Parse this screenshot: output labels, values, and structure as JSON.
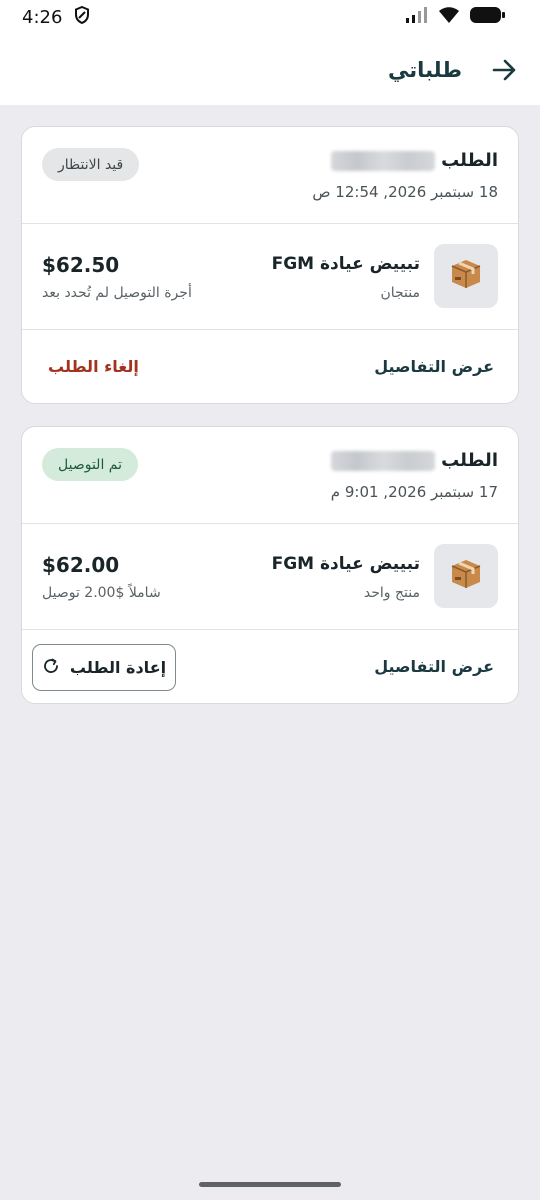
{
  "status_bar": {
    "time": "4:26"
  },
  "header": {
    "title": "طلباتي"
  },
  "orders": [
    {
      "order_label": "الطلب",
      "date": "18 سبتمبر 2026, 12:54 ص",
      "status": "قيد الانتظار",
      "product_name": "تبييض عيادة FGM",
      "product_count": "منتجان",
      "price": "$62.50",
      "price_note": "أجرة التوصيل لم تُحدد بعد",
      "details_label": "عرض التفاصيل",
      "action_label": "إلغاء الطلب"
    },
    {
      "order_label": "الطلب",
      "date": "17 سبتمبر 2026, 9:01 م",
      "status": "تم التوصيل",
      "product_name": "تبييض عيادة FGM",
      "product_count": "منتج واحد",
      "price": "$62.00",
      "price_note": "شاملاً $2.00 توصيل",
      "details_label": "عرض التفاصيل",
      "action_label": "إعادة الطلب"
    }
  ],
  "colors": {
    "pending_pill": "#e5e6e8",
    "delivered_pill": "#d4ebdc",
    "cancel_text": "#a3321f",
    "primary_text": "#1a3a40"
  },
  "icons": {
    "back": "arrow-right-icon",
    "product": "package-icon",
    "reorder": "refresh-icon"
  }
}
